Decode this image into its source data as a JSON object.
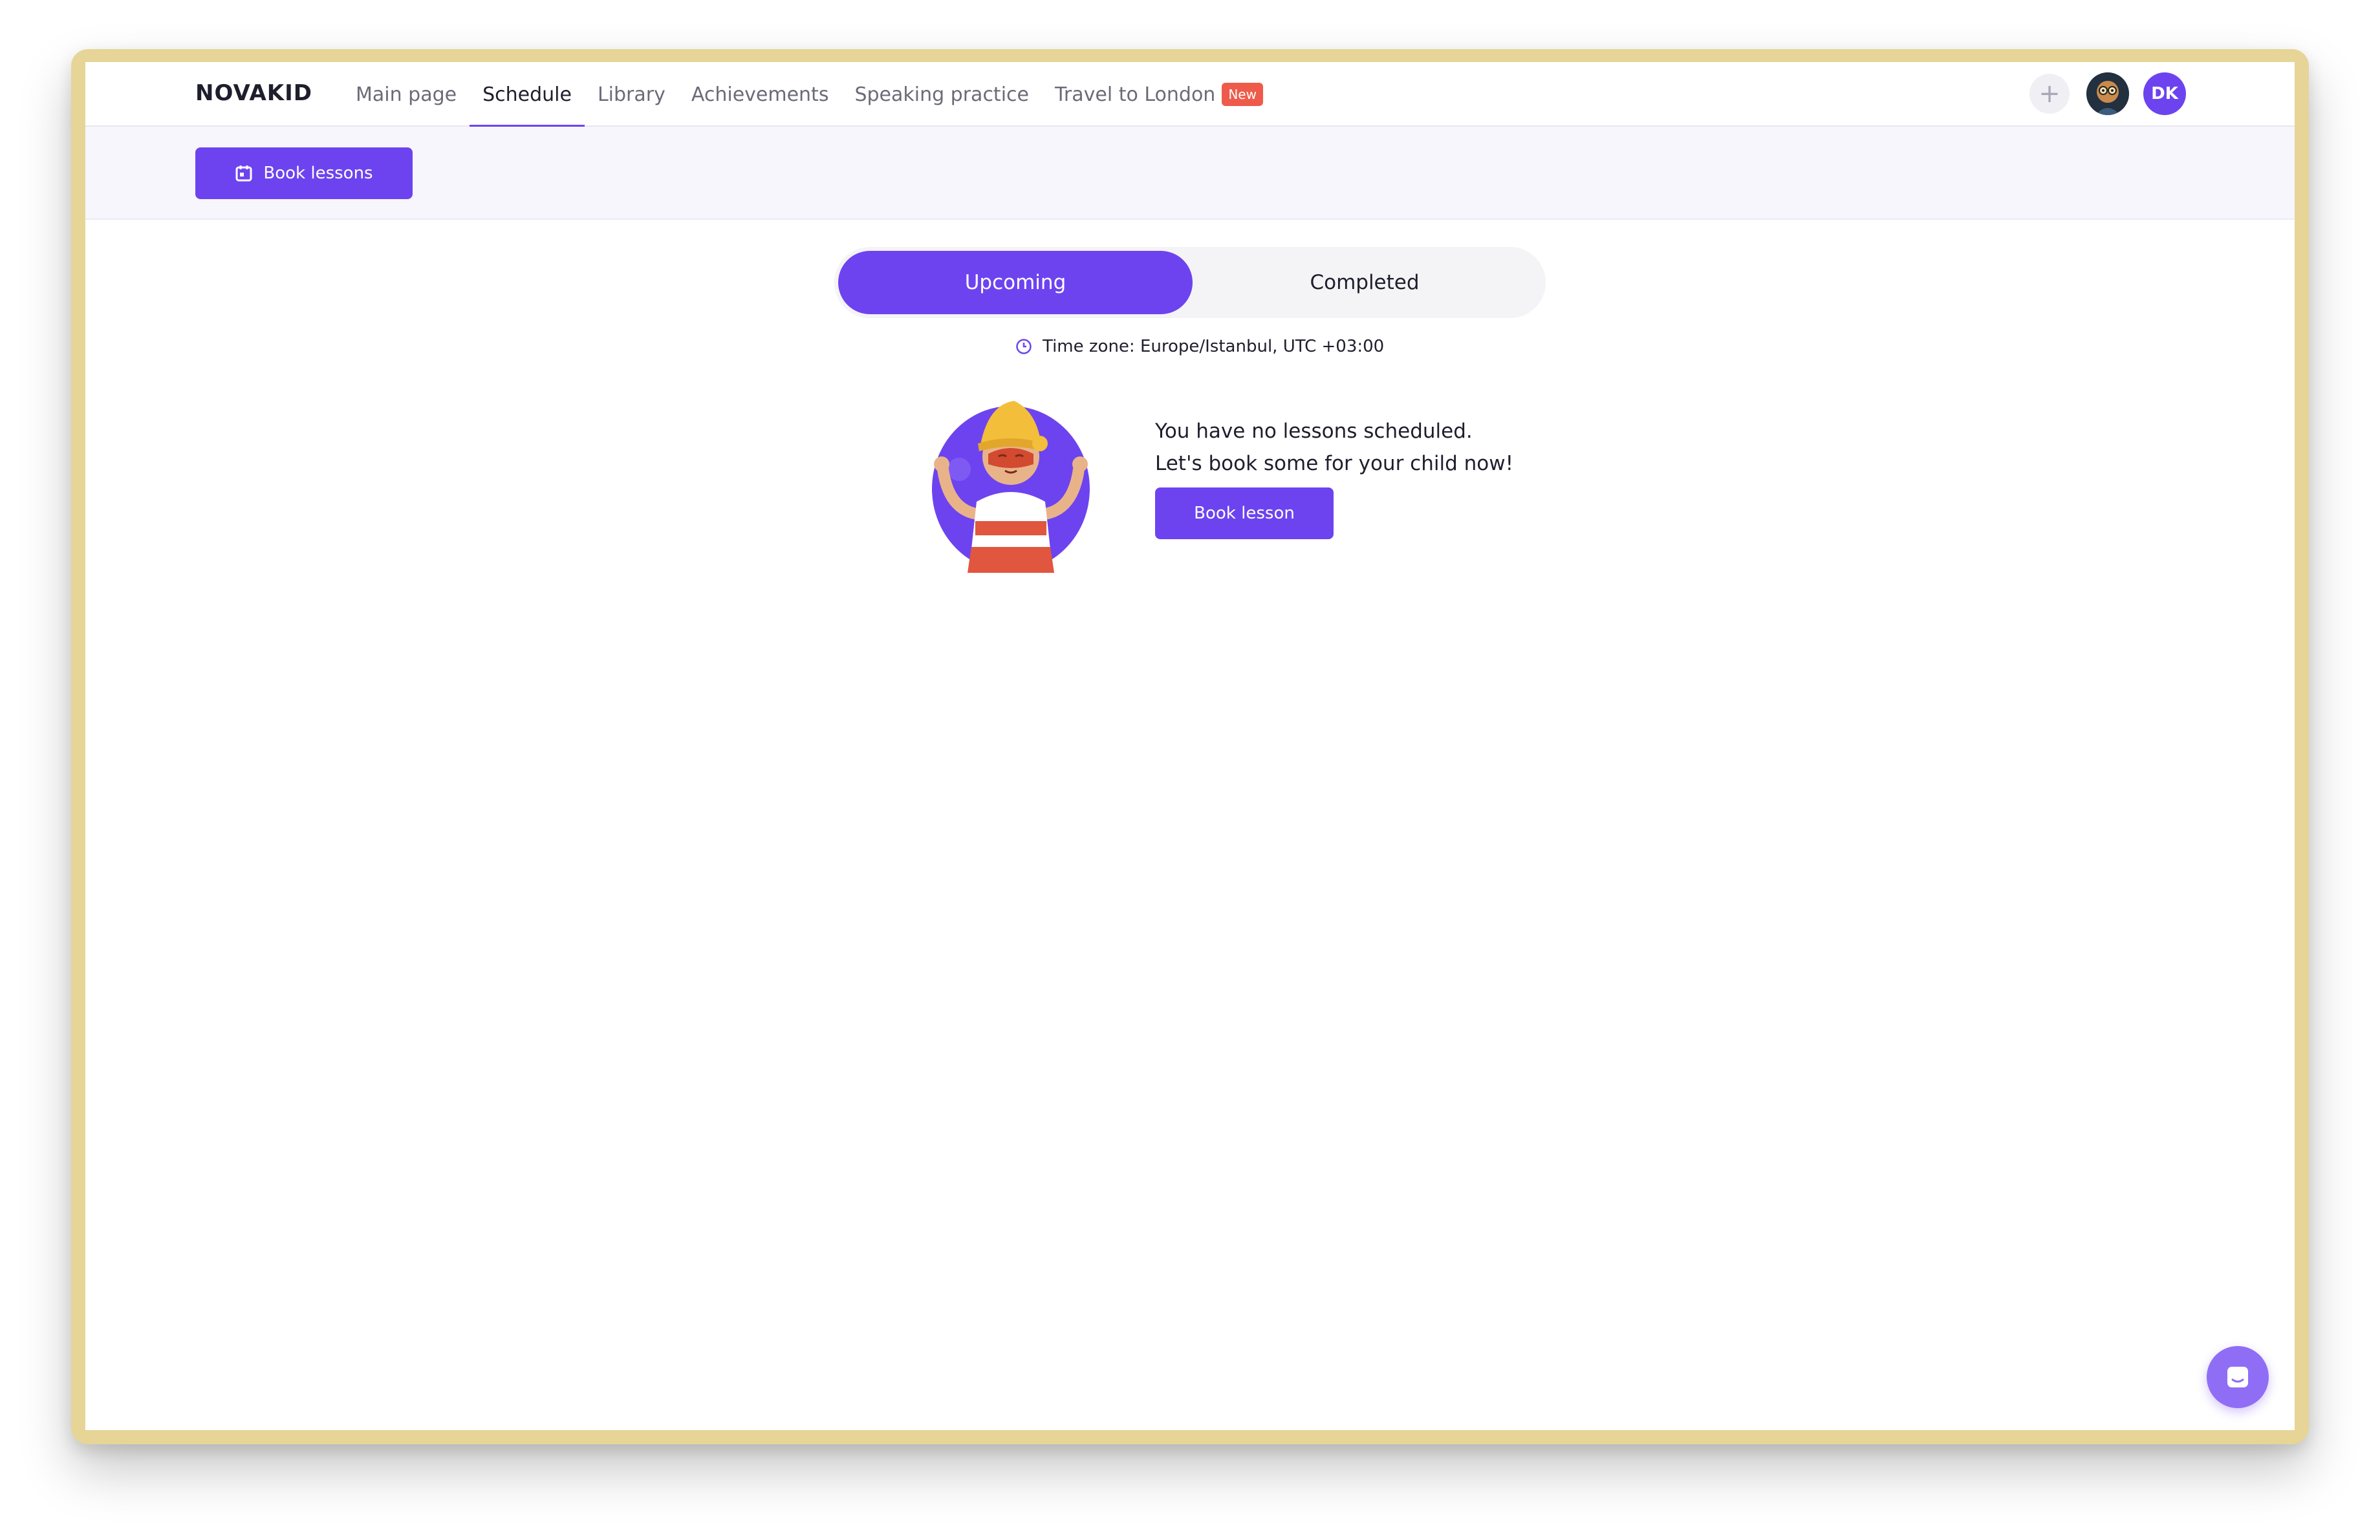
{
  "brand": {
    "logo": "NOVAKID"
  },
  "nav": {
    "items": [
      {
        "label": "Main page"
      },
      {
        "label": "Schedule",
        "active": true
      },
      {
        "label": "Library"
      },
      {
        "label": "Achievements"
      },
      {
        "label": "Speaking practice"
      },
      {
        "label": "Travel to London",
        "badge": "New"
      }
    ]
  },
  "header": {
    "initials": "DK",
    "add_icon": "plus-icon"
  },
  "toolbar": {
    "book_lessons_label": "Book lessons",
    "icon": "calendar-icon"
  },
  "tabs": {
    "upcoming": "Upcoming",
    "completed": "Completed",
    "selected": "Upcoming"
  },
  "timezone": {
    "text": "Time zone: Europe/Istanbul, UTC +03:00",
    "icon": "clock-icon"
  },
  "empty_state": {
    "line1": "You have no lessons scheduled.",
    "line2": "Let's book some for your child now!",
    "button_label": "Book lesson"
  },
  "chat": {
    "icon": "chat-icon"
  },
  "colors": {
    "accent": "#6d43f0",
    "badge": "#ee5b4b",
    "subbar": "#f7f6fd"
  }
}
